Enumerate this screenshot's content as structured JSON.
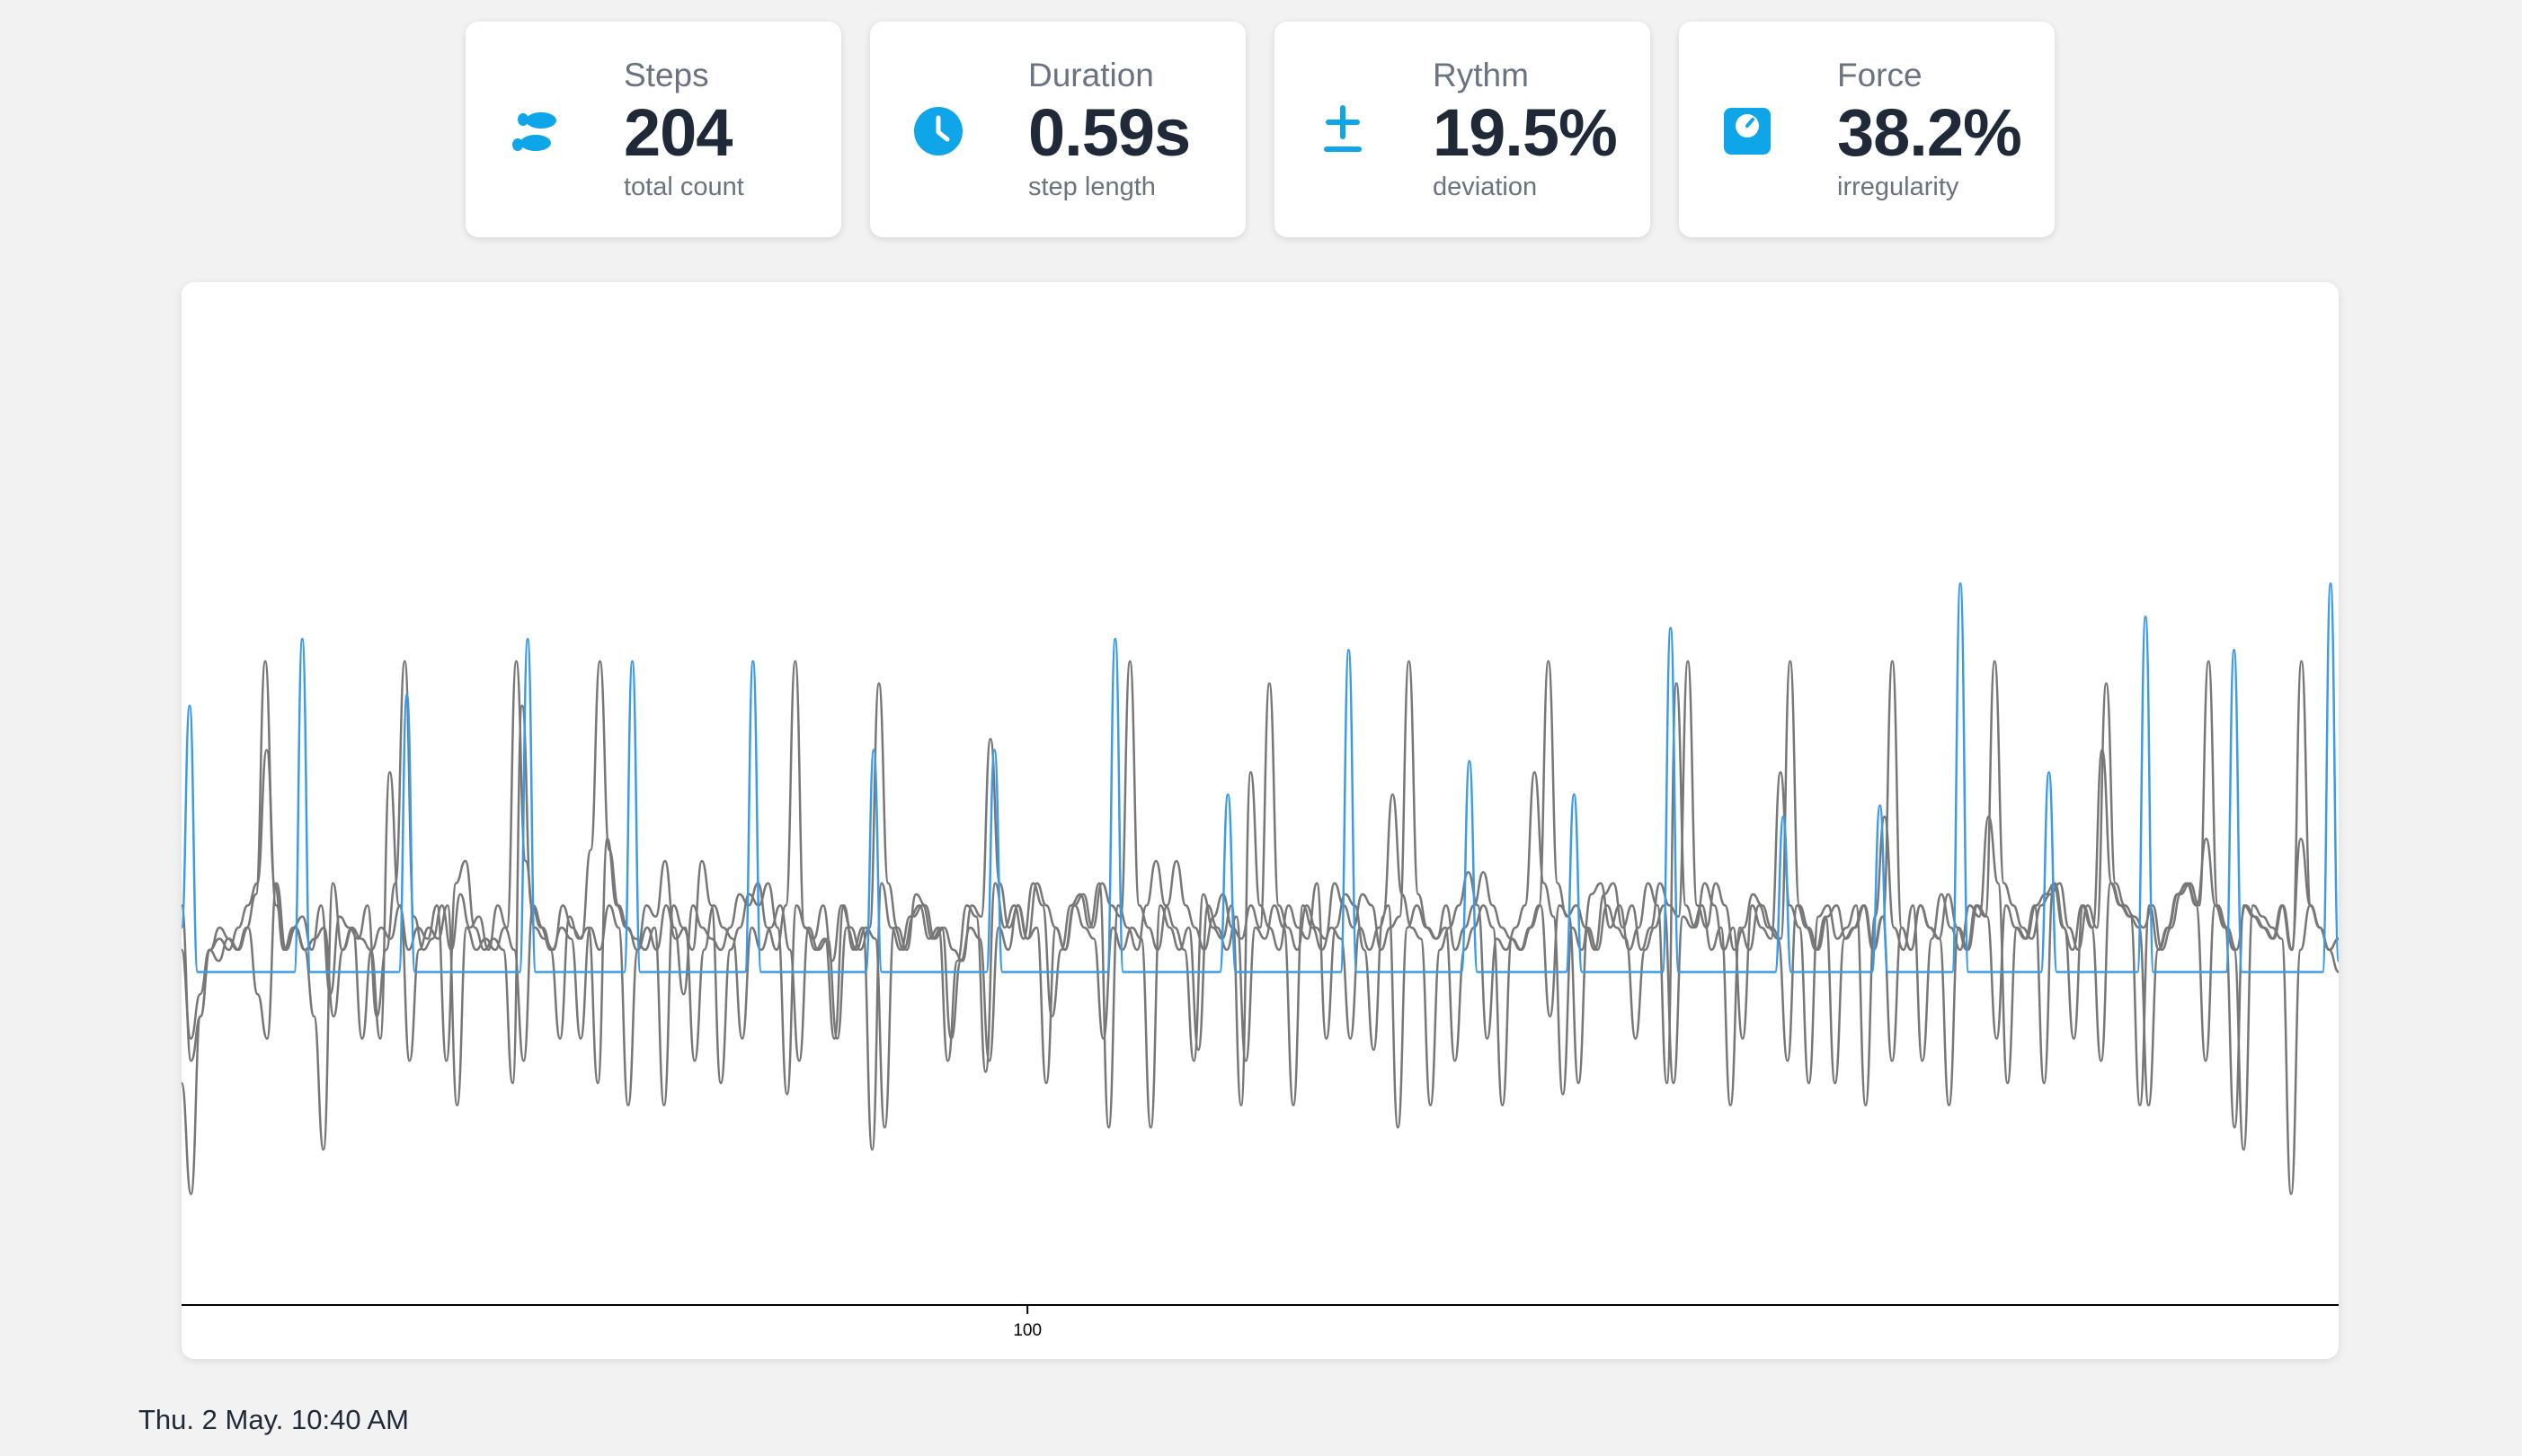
{
  "cards": [
    {
      "label": "Steps",
      "value": "204",
      "sub": "total count",
      "icon": "footsteps-icon"
    },
    {
      "label": "Duration",
      "value": "0.59s",
      "sub": "step length",
      "icon": "clock-icon"
    },
    {
      "label": "Rythm",
      "value": "19.5%",
      "sub": "deviation",
      "icon": "plus-minus-icon"
    },
    {
      "label": "Force",
      "value": "38.2%",
      "sub": "irregularity",
      "icon": "scale-icon"
    }
  ],
  "colors": {
    "accent": "#0ea5e9",
    "step_line": "#3b9be8",
    "signal_line": "#777777"
  },
  "timestamp": "Thu. 2 May. 10:40 AM",
  "chart_data": {
    "type": "line",
    "x_tick_labels": [
      "100"
    ],
    "xlim": [
      0,
      255
    ],
    "ylim": [
      -1.5,
      2.5
    ],
    "series": [
      {
        "values": [
          0.2,
          1.2,
          0,
          0,
          0,
          0,
          0,
          0,
          0,
          0,
          0,
          0,
          0,
          0,
          0,
          1.5,
          0,
          0,
          0,
          0,
          0,
          0,
          0,
          0,
          0,
          0,
          0,
          0,
          1.25,
          0,
          0,
          0,
          0,
          0,
          0,
          0,
          0,
          0,
          0,
          0,
          0,
          0,
          0,
          1.5,
          0,
          0,
          0,
          0,
          0,
          0,
          0,
          0,
          0,
          0,
          0,
          0,
          1.4,
          0,
          0,
          0,
          0,
          0,
          0,
          0,
          0,
          0,
          0,
          0,
          0,
          0,
          0,
          1.4,
          0,
          0,
          0,
          0,
          0,
          0,
          0,
          0,
          0,
          0,
          0,
          0,
          0,
          0,
          1.0,
          0,
          0,
          0,
          0,
          0,
          0,
          0,
          0,
          0,
          0,
          0,
          0,
          0,
          0,
          1.0,
          0,
          0,
          0,
          0,
          0,
          0,
          0,
          0,
          0,
          0,
          0,
          0,
          0,
          0,
          1.5,
          0,
          0,
          0,
          0,
          0,
          0,
          0,
          0,
          0,
          0,
          0,
          0,
          0,
          0.8,
          0,
          0,
          0,
          0,
          0,
          0,
          0,
          0,
          0,
          0,
          0,
          0,
          0,
          0,
          1.45,
          0,
          0,
          0,
          0,
          0,
          0,
          0,
          0,
          0,
          0,
          0,
          0,
          0,
          0,
          0.95,
          0,
          0,
          0,
          0,
          0,
          0,
          0,
          0,
          0,
          0,
          0,
          0,
          0.8,
          0,
          0,
          0,
          0,
          0,
          0,
          0,
          0,
          0,
          0,
          0,
          1.55,
          0,
          0,
          0,
          0,
          0,
          0,
          0,
          0,
          0,
          0,
          0,
          0,
          0,
          0.7,
          0,
          0,
          0,
          0,
          0,
          0,
          0,
          0,
          0,
          0,
          0,
          0.75,
          0,
          0,
          0,
          0,
          0,
          0,
          0,
          0,
          0,
          1.75,
          0,
          0,
          0,
          0,
          0,
          0,
          0,
          0,
          0,
          0,
          0.9,
          0,
          0,
          0,
          0,
          0,
          0,
          0,
          0,
          0,
          0,
          0,
          1.6,
          0,
          0,
          0,
          0,
          0,
          0,
          0,
          0,
          0,
          0,
          1.45,
          0,
          0,
          0,
          0,
          0,
          0,
          0,
          0,
          0,
          0,
          0,
          1.75,
          0.05
        ]
      },
      {
        "values": [
          0.1,
          -0.3,
          -0.1,
          0.1,
          0.05,
          0.15,
          0.1,
          0.2,
          0.35,
          1.4,
          0.4,
          0.1,
          0.2,
          0.25,
          0.1,
          0.3,
          -0.1,
          0.25,
          0.2,
          0.15,
          0.3,
          -0.2,
          0.1,
          0.4,
          1.4,
          0.25,
          0.1,
          0.15,
          0.3,
          0.1,
          0.35,
          0.2,
          0.25,
          0.1,
          0.3,
          0.2,
          1.4,
          0.5,
          0.2,
          0.15,
          0.1,
          0.3,
          0.2,
          0.15,
          0.55,
          1.4,
          0.55,
          0.3,
          0.2,
          0.1,
          0.3,
          0.25,
          0.5,
          0.2,
          -0.1,
          0.3,
          0.2,
          0.15,
          0.1,
          0.2,
          0.35,
          0.3,
          0.4,
          0.2,
          0.1,
          0.3,
          1.4,
          0.2,
          0.15,
          0.3,
          0.05,
          0.3,
          0.2,
          0.1,
          0.2,
          1.3,
          0.4,
          0.2,
          0.1,
          0.35,
          0.3,
          0.15,
          0.2,
          0.1,
          0.05,
          0.3,
          0.25,
          1.05,
          0.4,
          0.2,
          0.3,
          0.15,
          0.4,
          0.3,
          0.2,
          0.1,
          0.3,
          0.35,
          0.2,
          0.4,
          0.3,
          0.25,
          1.4,
          0.3,
          0.2,
          0.1,
          0.3,
          0.5,
          0.3,
          0.2,
          0.1,
          0.25,
          0.35,
          0.2,
          0.15,
          0.3,
          0.2,
          1.3,
          0.3,
          0.2,
          0.1,
          0.3,
          0.2,
          0.15,
          0.4,
          0.3,
          0.2,
          0.35,
          0.3,
          0.1,
          0.2,
          0.25,
          1.4,
          0.35,
          0.2,
          0.15,
          0.3,
          0.1,
          0.2,
          0.3,
          0.45,
          0.3,
          0.2,
          0.15,
          0.1,
          0.2,
          0.3,
          1.4,
          0.4,
          0.25,
          0.3,
          0.2,
          0.1,
          0.35,
          0.4,
          0.2,
          0.3,
          0.1,
          0.2,
          0.4,
          0.3,
          0.25,
          1.4,
          0.3,
          0.2,
          0.4,
          0.3,
          0.1,
          0.2,
          0.35,
          0.3,
          0.2,
          0.15,
          1.4,
          0.3,
          0.2,
          0.1,
          0.25,
          0.3,
          0.15,
          0.2,
          0.3,
          0.1,
          0.25,
          1.4,
          0.2,
          0.1,
          0.3,
          0.2,
          0.15,
          0.35,
          0.2,
          0.1,
          0.3,
          0.25,
          1.4,
          0.4,
          0.3,
          0.2,
          0.15,
          0.3,
          0.35,
          0.4,
          0.2,
          0.1,
          0.3,
          0.2,
          1.3,
          0.4,
          0.3,
          0.25,
          0.2,
          0.3,
          0.1,
          0.2,
          0.35,
          0.4,
          0.3,
          1.4,
          0.3,
          0.2,
          0.1,
          0.3,
          0.25,
          0.2,
          0.15,
          0.3,
          0.1,
          1.4,
          0.3,
          0.2,
          0.1,
          0.15
        ]
      },
      {
        "values": [
          -0.5,
          -1.0,
          -0.2,
          0.1,
          0.15,
          0.1,
          0.2,
          0.3,
          0.4,
          1.0,
          0.3,
          0.1,
          0.2,
          0.1,
          -0.2,
          -0.8,
          0.4,
          0.1,
          0.2,
          0.15,
          0.1,
          -0.3,
          0.9,
          0.3,
          0.1,
          0.2,
          0.15,
          0.3,
          -0.4,
          0.4,
          0.5,
          0.2,
          0.1,
          0.15,
          0.1,
          -0.5,
          1.2,
          0.3,
          0.2,
          0.1,
          -0.3,
          0.25,
          0.15,
          0.2,
          -0.5,
          0.6,
          0.3,
          0.2,
          0.15,
          0.1,
          0.2,
          -0.6,
          0.3,
          0.2,
          0.1,
          0.5,
          0.3,
          -0.5,
          0.1,
          0.2,
          0.35,
          0.3,
          0.4,
          0.2,
          -0.55,
          0.3,
          0.2,
          0.1,
          0.15,
          -0.3,
          0.3,
          0.1,
          0.2,
          -0.8,
          0.4,
          0.2,
          0.1,
          0.25,
          0.3,
          0.15,
          0.2,
          -0.4,
          0.05,
          0.3,
          0.25,
          -0.45,
          0.4,
          0.2,
          0.3,
          0.15,
          0.4,
          0.3,
          -0.2,
          0.1,
          0.3,
          0.35,
          0.2,
          0.4,
          -0.7,
          0.3,
          0.2,
          0.1,
          0.3,
          0.5,
          0.3,
          0.2,
          0.1,
          -0.4,
          0.35,
          0.2,
          0.15,
          0.3,
          -0.6,
          0.9,
          0.3,
          0.2,
          0.1,
          0.3,
          0.2,
          0.15,
          0.4,
          -0.3,
          0.2,
          0.35,
          0.3,
          0.1,
          -0.35,
          0.25,
          0.8,
          0.35,
          0.2,
          0.15,
          -0.6,
          0.1,
          0.2,
          0.3,
          0.45,
          0.3,
          -0.3,
          0.15,
          0.1,
          0.2,
          0.3,
          0.9,
          0.4,
          0.25,
          -0.55,
          0.2,
          0.1,
          0.35,
          0.4,
          0.2,
          0.3,
          0.1,
          0.2,
          0.4,
          0.3,
          -0.5,
          1.3,
          0.3,
          0.2,
          0.4,
          0.3,
          0.1,
          0.2,
          -0.3,
          0.3,
          0.2,
          0.15,
          0.9,
          0.3,
          0.2,
          -0.5,
          0.25,
          0.3,
          0.15,
          0.2,
          0.3,
          -0.6,
          0.25,
          0.7,
          0.2,
          0.1,
          0.3,
          -0.4,
          0.15,
          0.35,
          0.2,
          0.1,
          0.3,
          0.25,
          0.7,
          0.4,
          -0.5,
          0.2,
          0.15,
          0.3,
          0.35,
          0.4,
          0.2,
          -0.3,
          0.3,
          0.2,
          1.0,
          0.4,
          0.3,
          0.25,
          -0.6,
          0.3,
          0.1,
          0.2,
          0.35,
          0.4,
          0.3,
          0.6,
          0.3,
          0.2,
          -0.7,
          0.3,
          0.25,
          0.2,
          0.15,
          0.3,
          0.1,
          0.6,
          0.3,
          0.2,
          0.1,
          0.15
        ]
      },
      {
        "values": [
          0.3,
          -0.4,
          -0.2,
          0.1,
          0.2,
          0.15,
          0.1,
          0.2,
          -0.1,
          -0.3,
          0.4,
          0.1,
          0.2,
          0.1,
          0.15,
          0.2,
          -0.2,
          0.1,
          0.2,
          -0.3,
          0.1,
          0.2,
          0.15,
          0.3,
          -0.4,
          0.1,
          0.2,
          0.15,
          0.3,
          -0.6,
          0.2,
          0.1,
          0.15,
          0.1,
          0.2,
          0.1,
          -0.4,
          0.3,
          0.2,
          0.1,
          0.2,
          0.15,
          -0.3,
          0.2,
          0.1,
          0.3,
          0.2,
          -0.6,
          0.1,
          0.2,
          0.1,
          0.3,
          0.15,
          0.2,
          -0.4,
          0.1,
          0.3,
          0.2,
          0.15,
          -0.3,
          0.2,
          0.1,
          0.2,
          0.3,
          0.1,
          -0.4,
          0.2,
          0.1,
          0.15,
          -0.3,
          0.2,
          0.1,
          0.2,
          0.15,
          -0.7,
          0.2,
          0.1,
          0.25,
          0.3,
          0.15,
          0.2,
          -0.3,
          0.05,
          0.2,
          0.15,
          -0.4,
          0.2,
          0.1,
          0.3,
          0.15,
          0.2,
          -0.5,
          0.2,
          0.1,
          0.3,
          0.2,
          0.15,
          -0.3,
          0.2,
          0.1,
          0.2,
          0.15,
          -0.7,
          0.3,
          0.2,
          0.1,
          0.2,
          -0.35,
          0.3,
          0.2,
          0.1,
          0.25,
          -0.4,
          0.2,
          0.15,
          0.3,
          0.2,
          -0.6,
          0.3,
          0.2,
          0.1,
          0.2,
          0.15,
          -0.3,
          0.2,
          0.1,
          0.2,
          0.3,
          -0.7,
          0.2,
          0.3,
          0.2,
          0.15,
          0.2,
          -0.4,
          0.1,
          0.2,
          0.3,
          0.2,
          -0.6,
          0.15,
          0.1,
          0.2,
          0.3,
          -0.2,
          0.3,
          0.25,
          -0.5,
          0.2,
          0.1,
          0.3,
          0.2,
          0.15,
          -0.3,
          0.1,
          0.2,
          0.3,
          -0.5,
          0.25,
          0.2,
          0.3,
          0.1,
          0.2,
          -0.6,
          0.2,
          0.1,
          0.3,
          0.2,
          0.15,
          -0.4,
          0.3,
          0.2,
          0.1,
          0.25,
          -0.5,
          0.15,
          0.2,
          0.3,
          0.1,
          0.25,
          -0.4,
          0.2,
          0.1,
          0.3,
          0.2,
          0.15,
          -0.6,
          0.2,
          0.1,
          0.3,
          0.25,
          -0.3,
          0.3,
          0.2,
          0.15,
          0.3,
          -0.5,
          0.4,
          0.2,
          0.1,
          0.3,
          0.2,
          -0.4,
          0.4,
          0.3,
          0.25,
          0.2,
          -0.6,
          0.1,
          0.2,
          0.35,
          0.4,
          0.3,
          -0.4,
          0.3,
          0.2,
          0.1,
          -0.8,
          0.3,
          0.25,
          0.2,
          0.15,
          -1.0,
          0.1,
          0.3,
          0.2,
          0.1,
          0.0
        ]
      }
    ]
  }
}
